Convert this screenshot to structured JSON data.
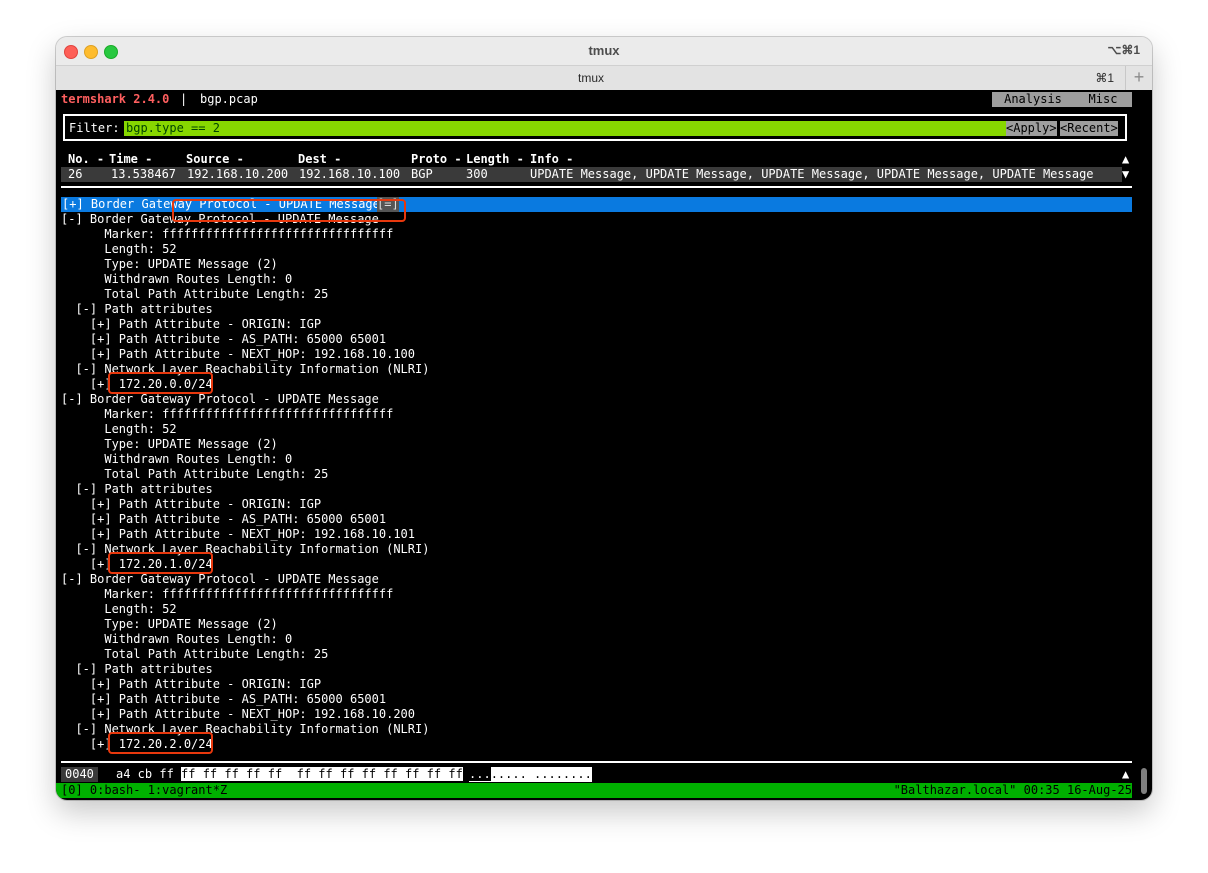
{
  "window": {
    "title": "tmux",
    "shortcut": "⌥⌘1"
  },
  "tab": {
    "label": "tmux",
    "shortcut": "⌘1",
    "new_tab": "+"
  },
  "header": {
    "app": "termshark 2.4.0",
    "separator": "|",
    "file": "bgp.pcap",
    "menu": [
      "Analysis",
      "Misc"
    ]
  },
  "filter": {
    "label": "Filter:",
    "value": "bgp.type == 2",
    "apply": "<Apply>",
    "recent": "<Recent>"
  },
  "packet_list": {
    "columns": [
      "No. -",
      "Time -",
      "Source -",
      "Dest -",
      "Proto -",
      "Length -",
      "Info -"
    ],
    "rows": [
      {
        "no": "26",
        "time": "13.538467",
        "source": "192.168.10.200",
        "dest": "192.168.10.100",
        "proto": "BGP",
        "length": "300",
        "info": "UPDATE Message, UPDATE Message, UPDATE Message, UPDATE Message, UPDATE Message"
      }
    ],
    "scroll_up": "▲",
    "scroll_down": "▼"
  },
  "tree": {
    "selected": {
      "text": "[+] Border Gateway Protocol - UPDATE Message",
      "badge": "[=]"
    },
    "lines": [
      "[-] Border Gateway Protocol - UPDATE Message",
      "      Marker: ffffffffffffffffffffffffffffffff",
      "      Length: 52",
      "      Type: UPDATE Message (2)",
      "      Withdrawn Routes Length: 0",
      "      Total Path Attribute Length: 25",
      "  [-] Path attributes",
      "    [+] Path Attribute - ORIGIN: IGP",
      "    [+] Path Attribute - AS_PATH: 65000 65001",
      "    [+] Path Attribute - NEXT_HOP: 192.168.10.100",
      "  [-] Network Layer Reachability Information (NLRI)",
      "    [+] 172.20.0.0/24",
      "[-] Border Gateway Protocol - UPDATE Message",
      "      Marker: ffffffffffffffffffffffffffffffff",
      "      Length: 52",
      "      Type: UPDATE Message (2)",
      "      Withdrawn Routes Length: 0",
      "      Total Path Attribute Length: 25",
      "  [-] Path attributes",
      "    [+] Path Attribute - ORIGIN: IGP",
      "    [+] Path Attribute - AS_PATH: 65000 65001",
      "    [+] Path Attribute - NEXT_HOP: 192.168.10.101",
      "  [-] Network Layer Reachability Information (NLRI)",
      "    [+] 172.20.1.0/24",
      "[-] Border Gateway Protocol - UPDATE Message",
      "      Marker: ffffffffffffffffffffffffffffffff",
      "      Length: 52",
      "      Type: UPDATE Message (2)",
      "      Withdrawn Routes Length: 0",
      "      Total Path Attribute Length: 25",
      "  [-] Path attributes",
      "    [+] Path Attribute - ORIGIN: IGP",
      "    [+] Path Attribute - AS_PATH: 65000 65001",
      "    [+] Path Attribute - NEXT_HOP: 192.168.10.200",
      "  [-] Network Layer Reachability Information (NLRI)",
      "    [+] 172.20.2.0/24"
    ]
  },
  "hex": {
    "offset": "0040",
    "bytes_plain": "a4 cb ff",
    "bytes_hl": "ff ff ff ff ff  ff ff ff ff ff ff ff ff",
    "ascii_plain": "...",
    "ascii_hl": "..... ........"
  },
  "status": {
    "left": "[0] 0:bash- 1:vagrant*Z",
    "right": "\"Balthazar.local\" 00:35 16-Aug-25"
  },
  "colors": {
    "app_title": "#ff5f5f",
    "filter_bg": "#87d700",
    "selection": "#0a7ae0",
    "status_bg": "#00b000",
    "annotation": "#e8380d"
  }
}
